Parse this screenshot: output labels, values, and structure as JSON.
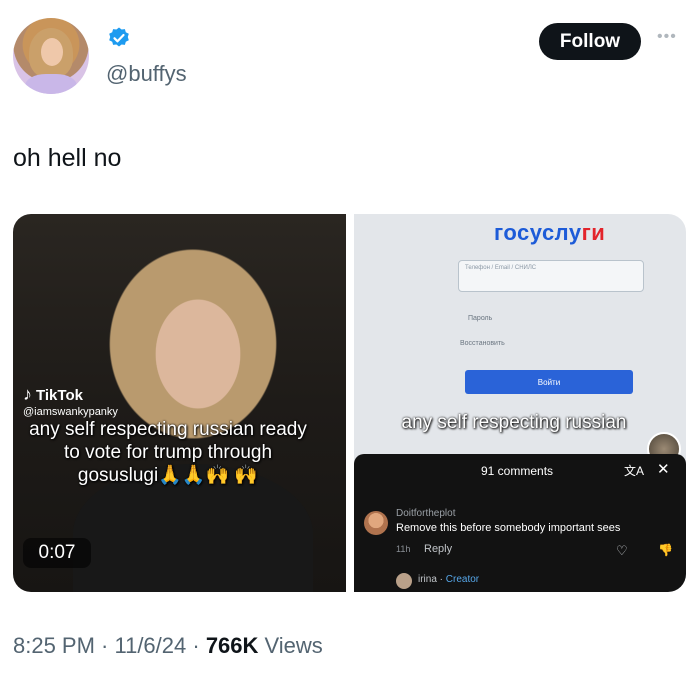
{
  "header": {
    "handle": "@buffys",
    "follow_label": "Follow",
    "more_label": "•••"
  },
  "tweet": {
    "text": "oh hell no"
  },
  "media_left": {
    "app_name": "TikTok",
    "username": "@iamswankypanky",
    "caption": "any self respecting russian ready to vote for trump through gosuslugi🙏🙏🙌 🙌",
    "duration": "0:07"
  },
  "media_right": {
    "logo_main": "госуслу",
    "logo_accent": "ги",
    "login_placeholder": "Телефон / Email / СНИЛС",
    "password_label": "Пароль",
    "recover_label": "Восстановить",
    "login_button": "Войти",
    "caption": "any self respecting russian",
    "comments": {
      "count_label": "91 comments",
      "translate_icon": "translate-icon",
      "commenter": "Doitfortheplot",
      "comment": "Remove this before somebody important sees",
      "time": "11h",
      "reply_label": "Reply",
      "reply_author": "irina",
      "reply_separator": " · ",
      "creator_label": "Creator"
    }
  },
  "footer": {
    "time": "8:25 PM · 11/6/24 · ",
    "views_count": "766K",
    "views_label": " Views"
  },
  "colors": {
    "follow_bg": "#0f1419",
    "verified": "#1d9bf0",
    "secondary_text": "#536471"
  }
}
